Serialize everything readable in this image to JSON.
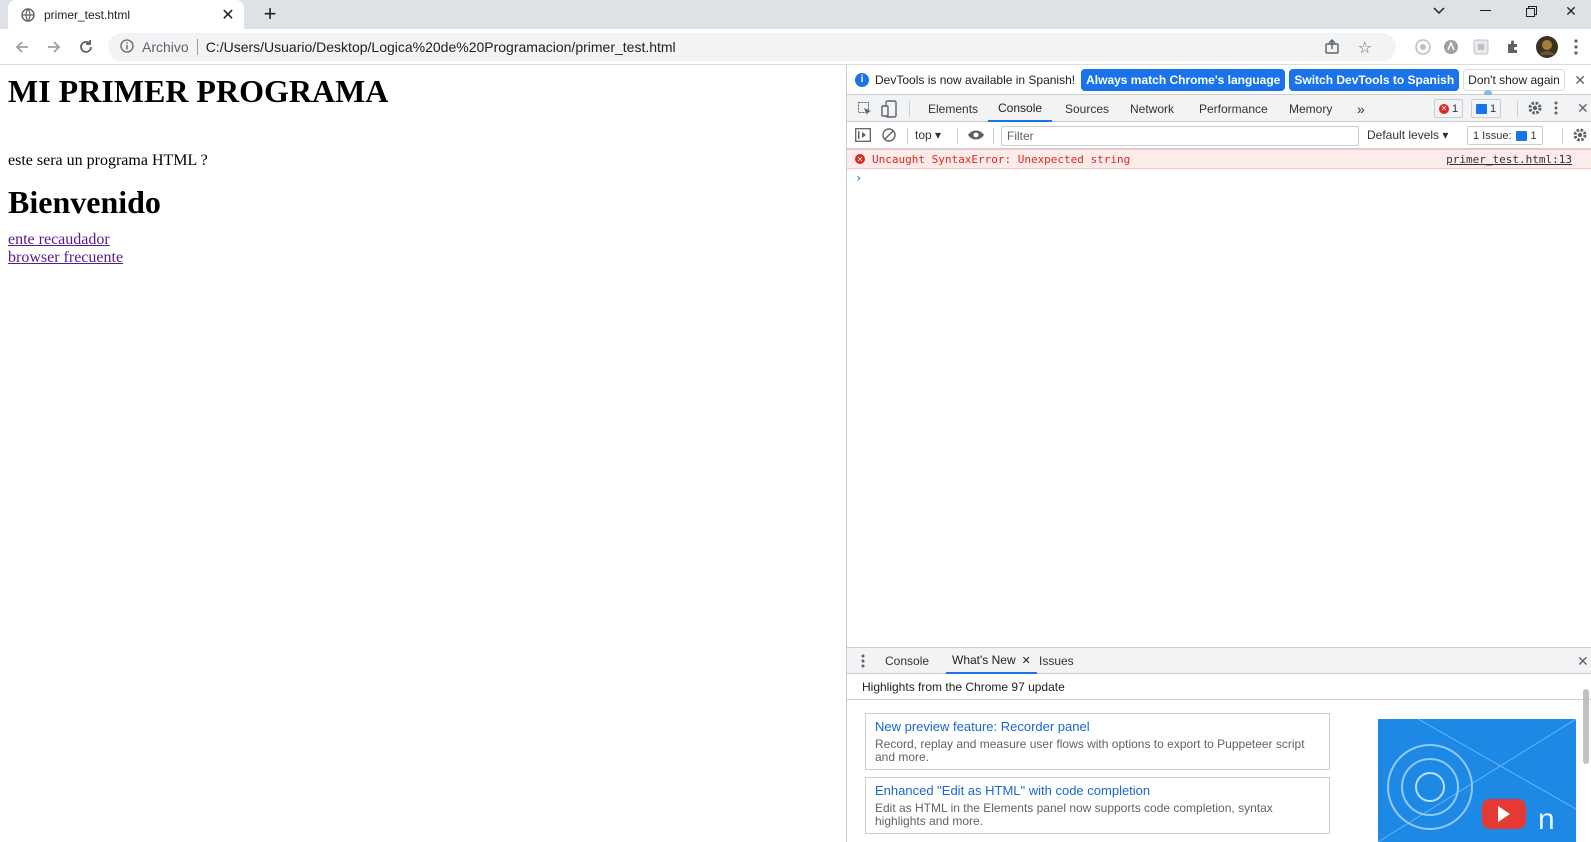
{
  "tab": {
    "title": "primer_test.html"
  },
  "toolbar": {
    "site_chip": "Archivo",
    "url": "C:/Users/Usuario/Desktop/Logica%20de%20Programacion/primer_test.html"
  },
  "page": {
    "heading": "MI PRIMER PROGRAMA",
    "paragraph": "este sera un programa HTML ?",
    "subheading": "Bienvenido",
    "links": [
      "ente recaudador",
      "browser frecuente"
    ]
  },
  "devtools": {
    "infobar": {
      "message": "DevTools is now available in Spanish!",
      "btn_match": "Always match Chrome's language",
      "btn_switch": "Switch DevTools to Spanish",
      "btn_dismiss": "Don't show again"
    },
    "tabs": [
      "Elements",
      "Console",
      "Sources",
      "Network",
      "Performance",
      "Memory"
    ],
    "more_tabs": "»",
    "error_count": "1",
    "message_count": "1",
    "console": {
      "context": "top",
      "filter_placeholder": "Filter",
      "levels": "Default levels",
      "issues_label": "1 Issue:",
      "issues_count": "1",
      "error_text": "Uncaught SyntaxError: Unexpected string",
      "error_source": "primer_test.html:13",
      "prompt": "›"
    },
    "drawer": {
      "tabs": [
        "Console",
        "What's New",
        "Issues"
      ],
      "highlights": "Highlights from the Chrome 97 update",
      "cards": [
        {
          "title": "New preview feature: Recorder panel",
          "desc": "Record, replay and measure user flows with options to export to Puppeteer script and more."
        },
        {
          "title": "Enhanced \"Edit as HTML\" with code completion",
          "desc": "Edit as HTML in the Elements panel now supports code completion, syntax highlights and more."
        }
      ]
    }
  },
  "colors": {
    "accent": "#1a73e8",
    "error": "#e0281a",
    "link_visited": "#551a8b"
  }
}
